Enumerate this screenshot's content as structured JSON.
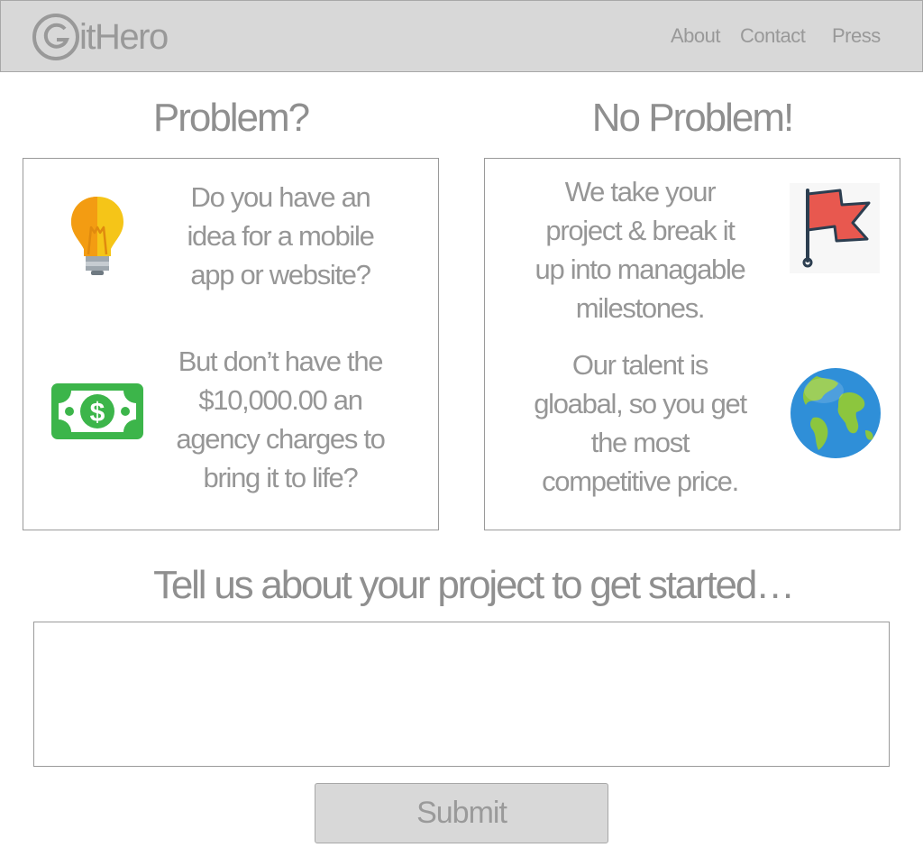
{
  "header": {
    "logo_text": "itHero",
    "nav": [
      "About",
      "Contact",
      "Press"
    ]
  },
  "problem": {
    "title": "Problem?",
    "items": [
      {
        "icon": "lightbulb-icon",
        "text": [
          "Do you have an",
          "idea for a mobile",
          "app or website?"
        ]
      },
      {
        "icon": "money-bill-icon",
        "text": [
          "But don’t have the",
          "$10,000.00 an",
          "agency charges to",
          "bring it to life?"
        ]
      }
    ]
  },
  "solution": {
    "title": "No Problem!",
    "items": [
      {
        "icon": "flag-icon",
        "text": [
          "We take your",
          "project & break it",
          "up into managable",
          "milestones."
        ]
      },
      {
        "icon": "globe-icon",
        "text": [
          "Our talent is",
          "gloabal, so you get",
          "the most",
          "competitive price."
        ]
      }
    ]
  },
  "cta": {
    "title": "Tell us about your project to get started…",
    "textarea_value": "",
    "submit_label": "Submit"
  },
  "colors": {
    "header_bg": "#d8d8d8",
    "text_gray": "#8f8f8f",
    "bulb_yellow": "#f5c518",
    "bulb_orange": "#f39c12",
    "money_green": "#3cb54a",
    "flag_red": "#e8584f",
    "globe_blue": "#2f8fd8",
    "globe_land": "#8cc63e"
  }
}
